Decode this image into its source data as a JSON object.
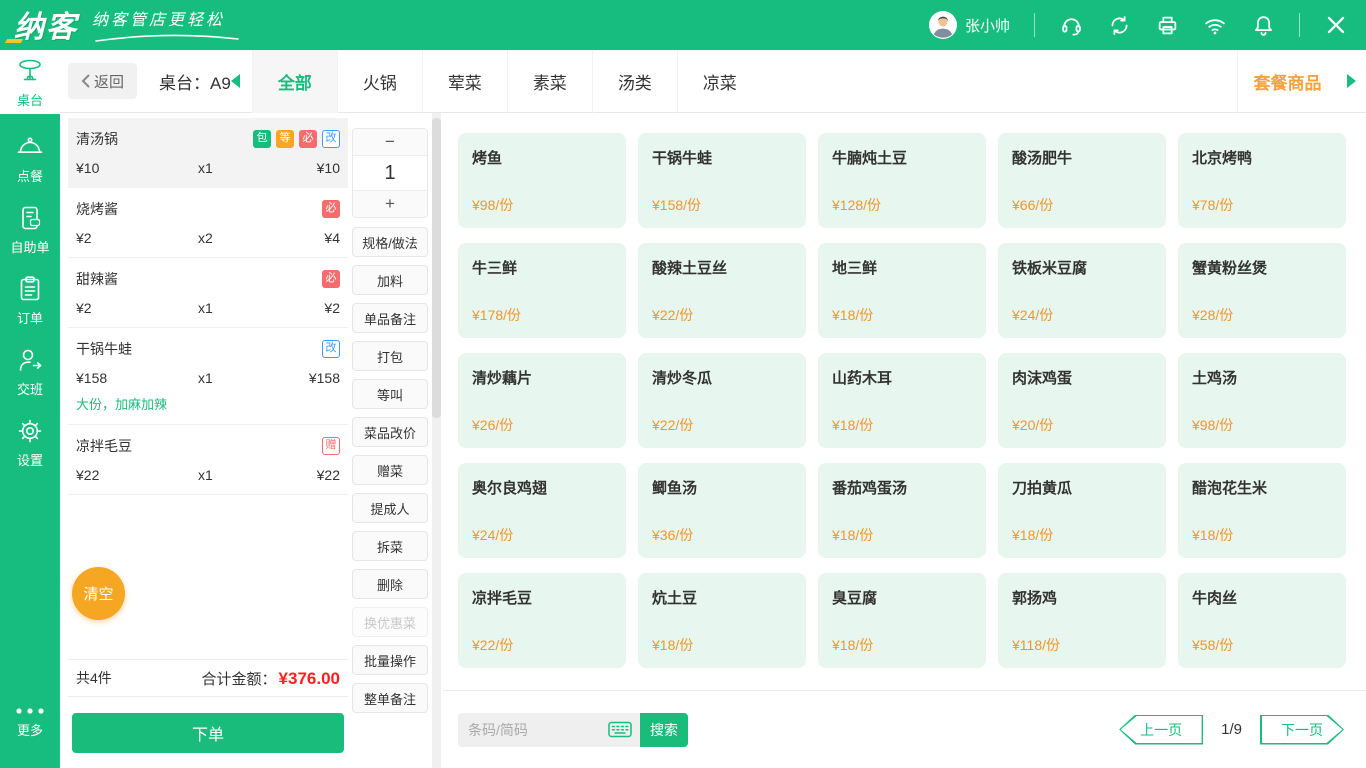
{
  "colors": {
    "brand_green": "#16BD7E",
    "button_green": "#1ABC7B",
    "accent_orange": "#F5A623",
    "price_orange": "#F0962B",
    "combo_orange": "#F5A23C",
    "badge_red": "#F56C6C",
    "badge_blue": "#3E9BFF",
    "total_red": "#FB2020",
    "card_mint": "#E7F6EE"
  },
  "topbar": {
    "logo": "纳客",
    "slogan": "纳客管店更轻松",
    "user": "张小帅",
    "icons": [
      "support-icon",
      "sync-icon",
      "printer-icon",
      "wifi-icon",
      "bell-icon",
      "close-icon"
    ]
  },
  "sidebar": {
    "items": [
      {
        "label": "桌台",
        "icon": "table-icon",
        "active": true
      },
      {
        "label": "点餐",
        "icon": "order-dish-icon",
        "active": false
      },
      {
        "label": "自助单",
        "icon": "self-service-icon",
        "active": false
      },
      {
        "label": "订单",
        "icon": "orders-icon",
        "active": false
      },
      {
        "label": "交班",
        "icon": "shift-handover-icon",
        "active": false
      },
      {
        "label": "设置",
        "icon": "settings-icon",
        "active": false
      }
    ],
    "more": "更多"
  },
  "header": {
    "back": "返回",
    "table": "桌台：A9",
    "tabs": [
      "全部",
      "火锅",
      "荤菜",
      "素菜",
      "汤类",
      "凉菜"
    ],
    "active_tab": "全部",
    "combo": "套餐商品"
  },
  "order": {
    "items": [
      {
        "name": "清汤锅",
        "price": "¥10",
        "qty": "x1",
        "total": "¥10",
        "selected": true,
        "badges": [
          {
            "text": "包",
            "style": "solid-green"
          },
          {
            "text": "等",
            "style": "solid-orange"
          },
          {
            "text": "必",
            "style": "solid-red"
          },
          {
            "text": "改",
            "style": "outline-blue"
          }
        ]
      },
      {
        "name": "烧烤酱",
        "price": "¥2",
        "qty": "x2",
        "total": "¥4",
        "selected": false,
        "badges": [
          {
            "text": "必",
            "style": "solid-red"
          }
        ]
      },
      {
        "name": "甜辣酱",
        "price": "¥2",
        "qty": "x1",
        "total": "¥2",
        "selected": false,
        "badges": [
          {
            "text": "必",
            "style": "solid-red"
          }
        ]
      },
      {
        "name": "干锅牛蛙",
        "price": "¥158",
        "qty": "x1",
        "total": "¥158",
        "selected": false,
        "badges": [
          {
            "text": "改",
            "style": "outline-blue"
          }
        ],
        "note": "大份，加麻加辣"
      },
      {
        "name": "凉拌毛豆",
        "price": "¥22",
        "qty": "x1",
        "total": "¥22",
        "selected": false,
        "badges": [
          {
            "text": "赠",
            "style": "outline-red"
          }
        ]
      }
    ],
    "clear": "清空",
    "summary_count": "共4件",
    "summary_label": "合计金额：",
    "summary_amount": "¥376.00",
    "submit": "下单"
  },
  "actions": {
    "qty_minus": "−",
    "qty_value": "1",
    "qty_plus": "+",
    "buttons": [
      {
        "label": "规格/做法",
        "disabled": false
      },
      {
        "label": "加料",
        "disabled": false
      },
      {
        "label": "单品备注",
        "disabled": false
      },
      {
        "label": "打包",
        "disabled": false
      },
      {
        "label": "等叫",
        "disabled": false
      },
      {
        "label": "菜品改价",
        "disabled": false
      },
      {
        "label": "赠菜",
        "disabled": false
      },
      {
        "label": "提成人",
        "disabled": false
      },
      {
        "label": "拆菜",
        "disabled": false
      },
      {
        "label": "删除",
        "disabled": false
      },
      {
        "label": "换优惠菜",
        "disabled": true
      },
      {
        "label": "批量操作",
        "disabled": false
      },
      {
        "label": "整单备注",
        "disabled": false
      }
    ]
  },
  "menu": {
    "items": [
      {
        "name": "烤鱼",
        "price": "¥98/份"
      },
      {
        "name": "干锅牛蛙",
        "price": "¥158/份"
      },
      {
        "name": "牛腩炖土豆",
        "price": "¥128/份"
      },
      {
        "name": "酸汤肥牛",
        "price": "¥66/份"
      },
      {
        "name": "北京烤鸭",
        "price": "¥78/份"
      },
      {
        "name": "牛三鲜",
        "price": "¥178/份"
      },
      {
        "name": "酸辣土豆丝",
        "price": "¥22/份"
      },
      {
        "name": "地三鲜",
        "price": "¥18/份"
      },
      {
        "name": "铁板米豆腐",
        "price": "¥24/份"
      },
      {
        "name": "蟹黄粉丝煲",
        "price": "¥28/份"
      },
      {
        "name": "清炒藕片",
        "price": "¥26/份"
      },
      {
        "name": "清炒冬瓜",
        "price": "¥22/份"
      },
      {
        "name": "山药木耳",
        "price": "¥18/份"
      },
      {
        "name": "肉沫鸡蛋",
        "price": "¥20/份"
      },
      {
        "name": "土鸡汤",
        "price": "¥98/份"
      },
      {
        "name": "奥尔良鸡翅",
        "price": "¥24/份"
      },
      {
        "name": "鲫鱼汤",
        "price": "¥36/份"
      },
      {
        "name": "番茄鸡蛋汤",
        "price": "¥18/份"
      },
      {
        "name": "刀拍黄瓜",
        "price": "¥18/份"
      },
      {
        "name": "醋泡花生米",
        "price": "¥18/份"
      },
      {
        "name": "凉拌毛豆",
        "price": "¥22/份"
      },
      {
        "name": "炕土豆",
        "price": "¥18/份"
      },
      {
        "name": "臭豆腐",
        "price": "¥18/份"
      },
      {
        "name": "郭扬鸡",
        "price": "¥118/份"
      },
      {
        "name": "牛肉丝",
        "price": "¥58/份"
      }
    ]
  },
  "footer": {
    "search_placeholder": "条码/简码",
    "search_button": "搜索",
    "prev": "上一页",
    "page_info": "1/9",
    "next": "下一页"
  }
}
